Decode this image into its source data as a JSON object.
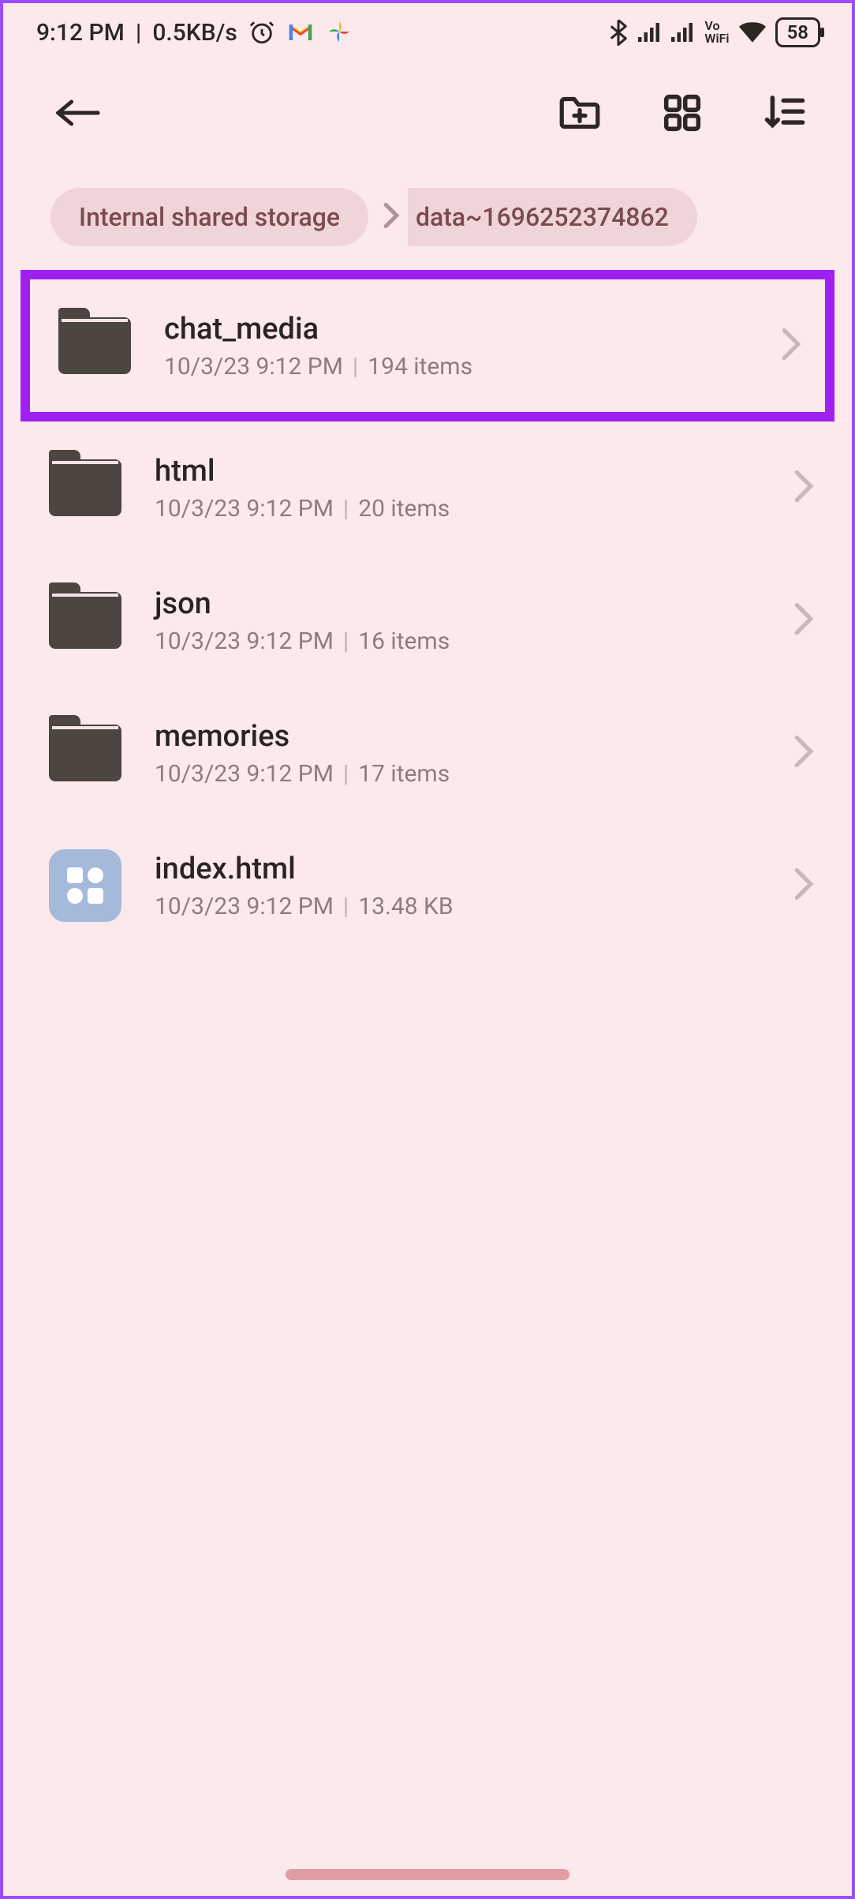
{
  "status": {
    "time": "9:12 PM",
    "net_speed": "0.5KB/s",
    "battery": "58",
    "vowifi_top": "Vo",
    "vowifi_bottom": "WiFi"
  },
  "breadcrumb": {
    "root": "Internal shared storage",
    "current": "data~1696252374862"
  },
  "items": [
    {
      "type": "folder",
      "name": "chat_media",
      "date": "10/3/23 9:12 PM",
      "info": "194 items",
      "highlight": true
    },
    {
      "type": "folder",
      "name": "html",
      "date": "10/3/23 9:12 PM",
      "info": "20 items",
      "highlight": false
    },
    {
      "type": "folder",
      "name": "json",
      "date": "10/3/23 9:12 PM",
      "info": "16 items",
      "highlight": false
    },
    {
      "type": "folder",
      "name": "memories",
      "date": "10/3/23 9:12 PM",
      "info": "17 items",
      "highlight": false
    },
    {
      "type": "file",
      "name": "index.html",
      "date": "10/3/23 9:12 PM",
      "info": "13.48 KB",
      "highlight": false
    }
  ]
}
